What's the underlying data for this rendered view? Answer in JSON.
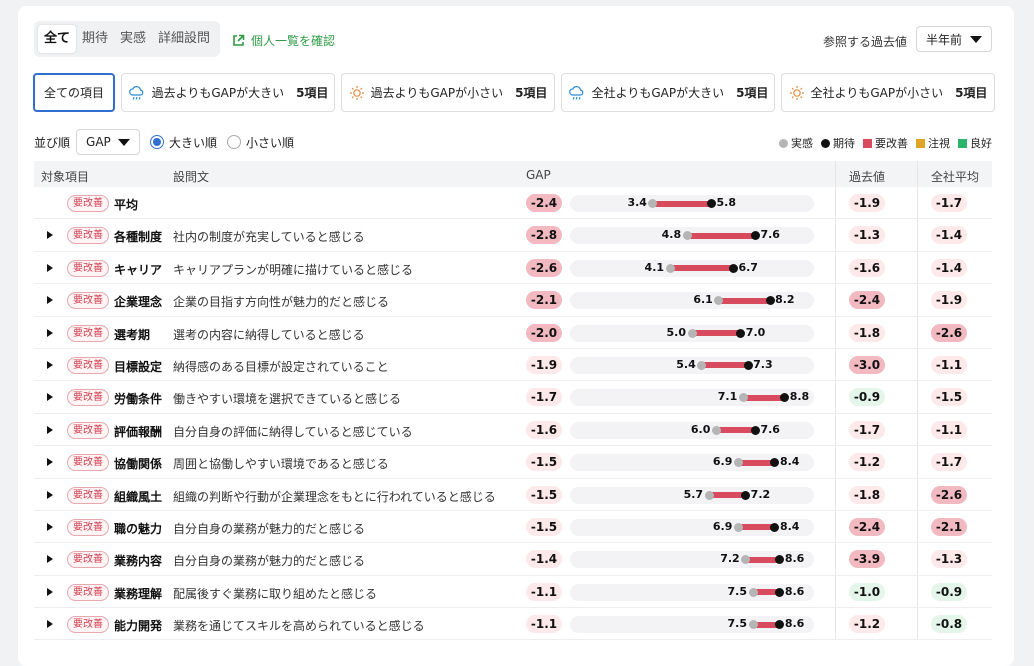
{
  "tabs": [
    {
      "label": "全て",
      "active": true
    },
    {
      "label": "期待",
      "active": false
    },
    {
      "label": "実感",
      "active": false
    },
    {
      "label": "詳細設問",
      "active": false
    }
  ],
  "individual_link": "個人一覧を確認",
  "reference": {
    "label": "参照する過去値",
    "value": "半年前"
  },
  "filters": [
    {
      "label": "全ての項目",
      "count": "",
      "icon": "",
      "active": true
    },
    {
      "label": "過去よりもGAPが大きい",
      "count": "5項目",
      "icon": "rain-cloud-icon",
      "active": false
    },
    {
      "label": "過去よりもGAPが小さい",
      "count": "5項目",
      "icon": "sun-icon",
      "active": false
    },
    {
      "label": "全社よりもGAPが大きい",
      "count": "5項目",
      "icon": "rain-cloud-icon",
      "active": false
    },
    {
      "label": "全社よりもGAPが小さい",
      "count": "5項目",
      "icon": "sun-icon",
      "active": false
    }
  ],
  "sort": {
    "label": "並び順",
    "value": "GAP",
    "desc_label": "大きい順",
    "asc_label": "小さい順",
    "selected": "desc"
  },
  "legend": [
    {
      "label": "実感",
      "color": "#b5b5b5",
      "shape": "dot"
    },
    {
      "label": "期待",
      "color": "#111111",
      "shape": "dot"
    },
    {
      "label": "要改善",
      "color": "#d84a5d",
      "shape": "square"
    },
    {
      "label": "注視",
      "color": "#e0a526",
      "shape": "square"
    },
    {
      "label": "良好",
      "color": "#2eb36b",
      "shape": "square"
    }
  ],
  "columns": {
    "item": "対象項目",
    "question": "設問文",
    "gap": "GAP",
    "past": "過去値",
    "company": "全社平均"
  },
  "colors": {
    "bad": "#d84a5d",
    "bad_pill_strong": "#f2b9c1",
    "bad_pill_light": "#fde8ea",
    "good_pill": "#e4f5ea"
  },
  "rows": [
    {
      "badge": "要改善",
      "item": "平均",
      "question": "",
      "gap": "-2.4",
      "actual": 3.4,
      "expect": 5.8,
      "actual_label": "3.4",
      "expect_label": "5.8",
      "past": "-1.9",
      "company": "-1.7",
      "expandable": false
    },
    {
      "badge": "要改善",
      "item": "各種制度",
      "question": "社内の制度が充実していると感じる",
      "gap": "-2.8",
      "actual": 4.8,
      "expect": 7.6,
      "actual_label": "4.8",
      "expect_label": "7.6",
      "past": "-1.3",
      "company": "-1.4",
      "expandable": true
    },
    {
      "badge": "要改善",
      "item": "キャリア",
      "question": "キャリアプランが明確に描けていると感じる",
      "gap": "-2.6",
      "actual": 4.1,
      "expect": 6.7,
      "actual_label": "4.1",
      "expect_label": "6.7",
      "past": "-1.6",
      "company": "-1.4",
      "expandable": true
    },
    {
      "badge": "要改善",
      "item": "企業理念",
      "question": "企業の目指す方向性が魅力的だと感じる",
      "gap": "-2.1",
      "actual": 6.1,
      "expect": 8.2,
      "actual_label": "6.1",
      "expect_label": "8.2",
      "past": "-2.4",
      "company": "-1.9",
      "expandable": true
    },
    {
      "badge": "要改善",
      "item": "選考期",
      "question": "選考の内容に納得していると感じる",
      "gap": "-2.0",
      "actual": 5.0,
      "expect": 7.0,
      "actual_label": "5.0",
      "expect_label": "7.0",
      "past": "-1.8",
      "company": "-2.6",
      "expandable": true
    },
    {
      "badge": "要改善",
      "item": "目標設定",
      "question": "納得感のある目標が設定されていること",
      "gap": "-1.9",
      "actual": 5.4,
      "expect": 7.3,
      "actual_label": "5.4",
      "expect_label": "7.3",
      "past": "-3.0",
      "company": "-1.1",
      "expandable": true
    },
    {
      "badge": "要改善",
      "item": "労働条件",
      "question": "働きやすい環境を選択できていると感じる",
      "gap": "-1.7",
      "actual": 7.1,
      "expect": 8.8,
      "actual_label": "7.1",
      "expect_label": "8.8",
      "past": "-0.9",
      "company": "-1.5",
      "expandable": true
    },
    {
      "badge": "要改善",
      "item": "評価報酬",
      "question": "自分自身の評価に納得していると感じている",
      "gap": "-1.6",
      "actual": 6.0,
      "expect": 7.6,
      "actual_label": "6.0",
      "expect_label": "7.6",
      "past": "-1.7",
      "company": "-1.1",
      "expandable": true
    },
    {
      "badge": "要改善",
      "item": "協働関係",
      "question": "周囲と協働しやすい環境であると感じる",
      "gap": "-1.5",
      "actual": 6.9,
      "expect": 8.4,
      "actual_label": "6.9",
      "expect_label": "8.4",
      "past": "-1.2",
      "company": "-1.7",
      "expandable": true
    },
    {
      "badge": "要改善",
      "item": "組織風土",
      "question": "組織の判断や行動が企業理念をもとに行われていると感じる",
      "gap": "-1.5",
      "actual": 5.7,
      "expect": 7.2,
      "actual_label": "5.7",
      "expect_label": "7.2",
      "past": "-1.8",
      "company": "-2.6",
      "expandable": true
    },
    {
      "badge": "要改善",
      "item": "職の魅力",
      "question": "自分自身の業務が魅力的だと感じる",
      "gap": "-1.5",
      "actual": 6.9,
      "expect": 8.4,
      "actual_label": "6.9",
      "expect_label": "8.4",
      "past": "-2.4",
      "company": "-2.1",
      "expandable": true
    },
    {
      "badge": "要改善",
      "item": "業務内容",
      "question": "自分自身の業務が魅力的だと感じる",
      "gap": "-1.4",
      "actual": 7.2,
      "expect": 8.6,
      "actual_label": "7.2",
      "expect_label": "8.6",
      "past": "-3.9",
      "company": "-1.3",
      "expandable": true
    },
    {
      "badge": "要改善",
      "item": "業務理解",
      "question": "配属後すぐ業務に取り組めたと感じる",
      "gap": "-1.1",
      "actual": 7.5,
      "expect": 8.6,
      "actual_label": "7.5",
      "expect_label": "8.6",
      "past": "-1.0",
      "company": "-0.9",
      "expandable": true
    },
    {
      "badge": "要改善",
      "item": "能力開発",
      "question": "業務を通じてスキルを高められていると感じる",
      "gap": "-1.1",
      "actual": 7.5,
      "expect": 8.6,
      "actual_label": "7.5",
      "expect_label": "8.6",
      "past": "-1.2",
      "company": "-0.8",
      "expandable": true
    }
  ]
}
